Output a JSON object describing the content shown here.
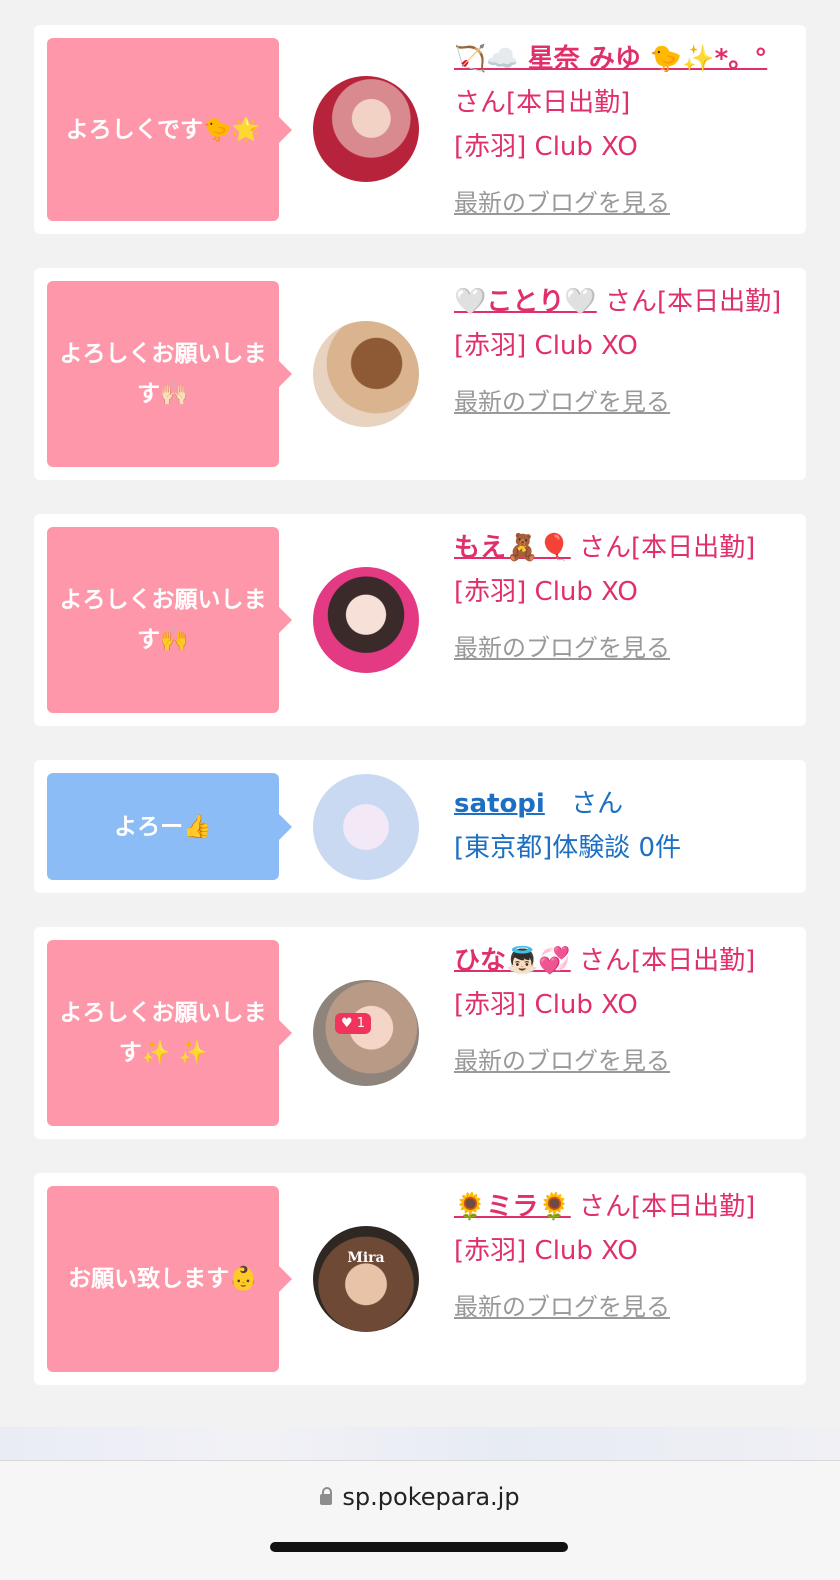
{
  "entries": [
    {
      "message": "よろしくです🐤🌟",
      "name": "🏹☁️ 星奈 みゆ 🐤✨*。°",
      "san": "さん[本日出勤]",
      "shop": "[赤羽] Club XO",
      "blog": "最新のブログを見る"
    },
    {
      "message": "よろしくお願いします🙌🏻",
      "name": "🤍ことり🤍",
      "san": "さん[本日出勤]",
      "shop": "[赤羽] Club XO",
      "blog": "最新のブログを見る"
    },
    {
      "message": "よろしくお願いします🙌",
      "name": "もえ🧸🎈",
      "san": "さん[本日出勤]",
      "shop": "[赤羽] Club XO",
      "blog": "最新のブログを見る"
    },
    {
      "message": "よろー👍",
      "name": "satopi",
      "san": "さん",
      "shop": "[東京都]体験談 0件"
    },
    {
      "message": "よろしくお願いします✨ ✨",
      "name": "ひな👼🏻💞",
      "san": "さん[本日出勤]",
      "shop": "[赤羽] Club XO",
      "blog": "最新のブログを見る"
    },
    {
      "message": "お願い致します👶",
      "name": "🌻ミラ🌻",
      "san": "さん[本日出勤]",
      "shop": "[赤羽] Club XO",
      "blog": "最新のブログを見る",
      "avatar_text": "Mira"
    }
  ],
  "browser": {
    "url": "sp.pokepara.jp"
  },
  "colors": {
    "pink_bubble": "#fe97a9",
    "blue_bubble": "#8cbcf5",
    "pink_text": "#e0306a",
    "blue_text": "#1c6fc2"
  }
}
